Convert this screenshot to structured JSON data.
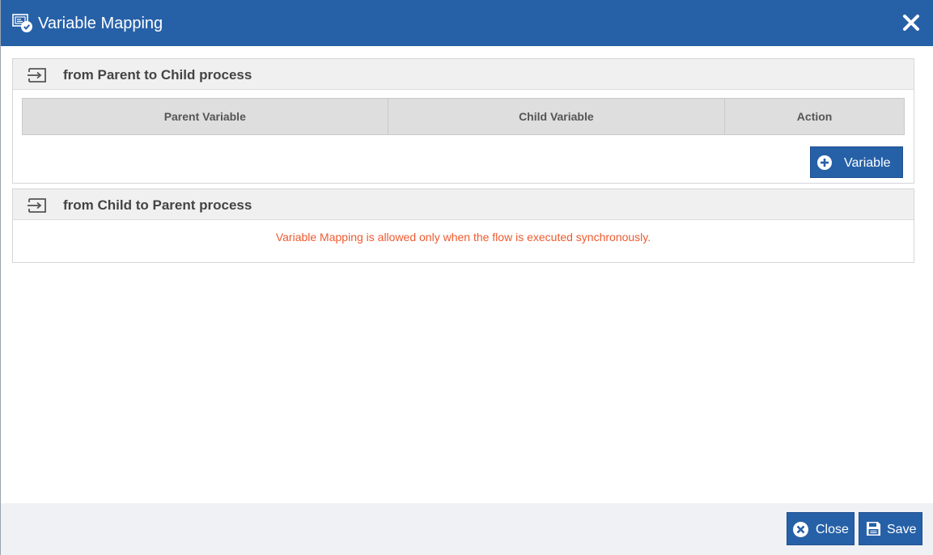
{
  "dialog": {
    "title": "Variable Mapping",
    "title_icon": "variable-mapping-icon",
    "close_icon": "close-icon"
  },
  "parent_to_child": {
    "header": "from Parent to Child process",
    "icon": "sign-in-arrow-icon",
    "columns": [
      "Parent Variable",
      "Child Variable",
      "Action"
    ],
    "rows": [],
    "add_button_label": "Variable",
    "add_button_icon": "plus-circle-icon"
  },
  "child_to_parent": {
    "header": "from Child to Parent process",
    "icon": "sign-in-arrow-icon",
    "notice": "Variable Mapping is allowed only when the flow is executed synchronously."
  },
  "footer": {
    "close_label": "Close",
    "close_icon": "times-circle-icon",
    "save_label": "Save",
    "save_icon": "floppy-disk-icon"
  },
  "colors": {
    "titlebar": "#2661a8",
    "button": "#2661a8",
    "notice_text": "#ee5a2f",
    "panel_header": "#f1f0f0",
    "footer": "#eff1f5"
  }
}
